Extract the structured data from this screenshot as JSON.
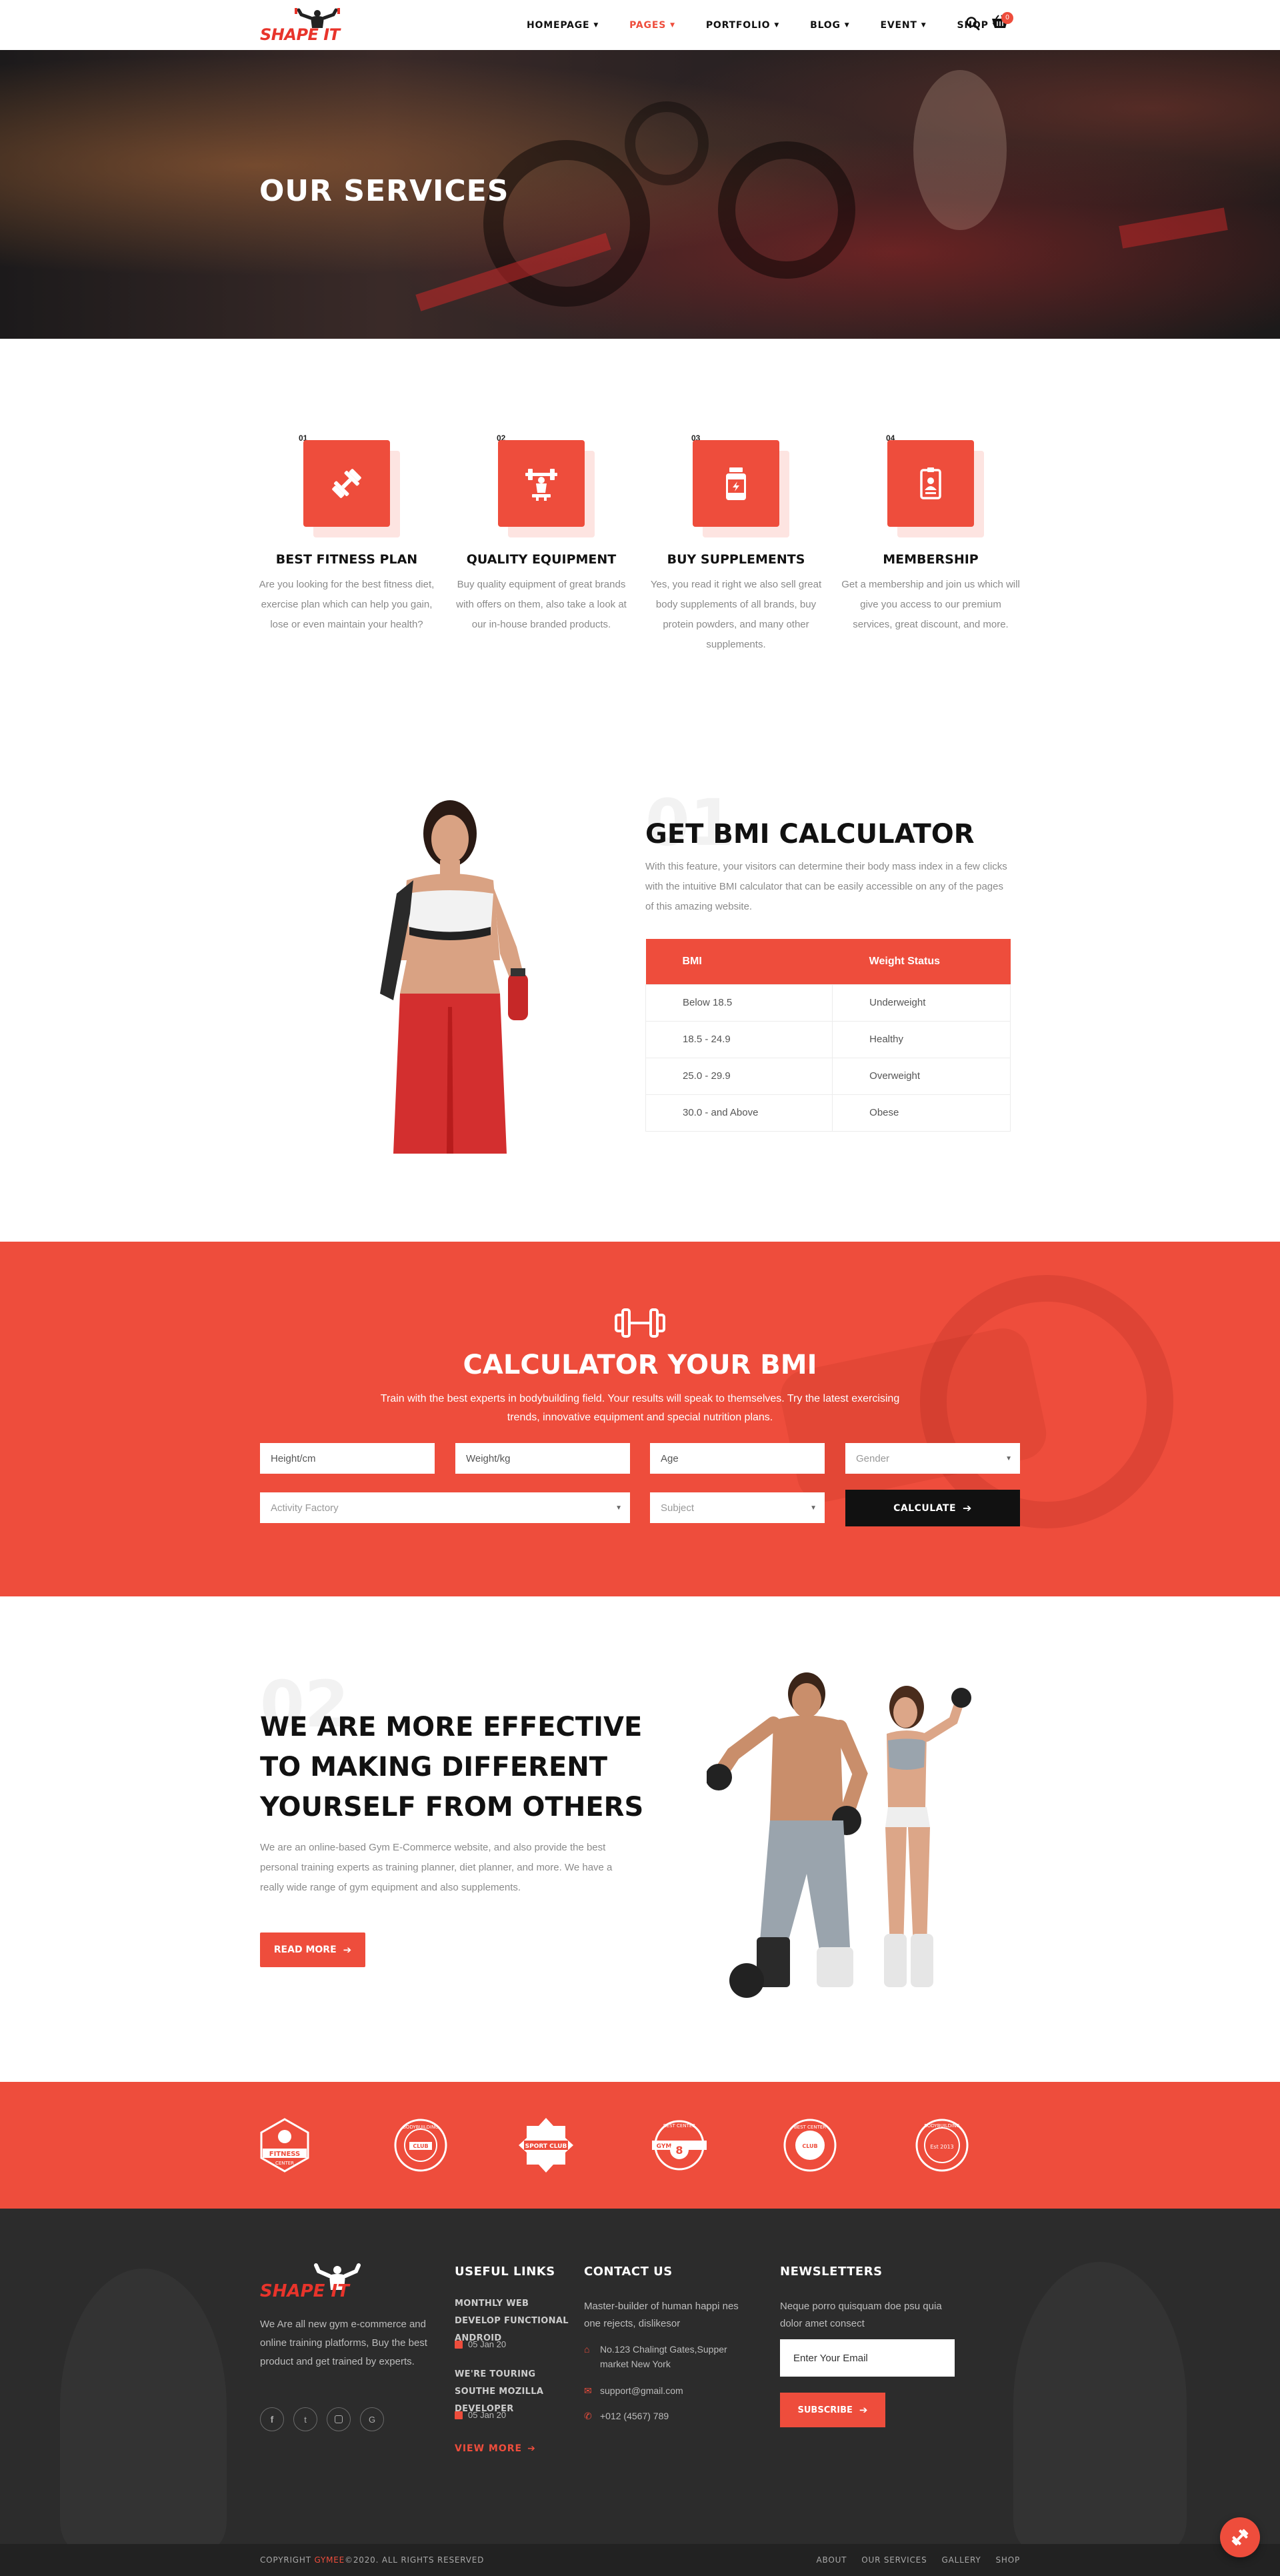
{
  "brand": {
    "logo_text": "SHAPE IT",
    "accent": "#ee4d3c"
  },
  "nav": {
    "items": [
      {
        "label": "HOMEPAGE",
        "active": false
      },
      {
        "label": "PAGES",
        "active": true
      },
      {
        "label": "PORTFOLIO",
        "active": false
      },
      {
        "label": "BLOG",
        "active": false
      },
      {
        "label": "EVENT",
        "active": false
      },
      {
        "label": "SHOP",
        "active": false
      }
    ],
    "cart_count": "0",
    "icons": [
      "search-icon",
      "cart-icon"
    ]
  },
  "hero": {
    "title": "OUR SERVICES"
  },
  "services": [
    {
      "num": "01",
      "title": "BEST FITNESS PLAN",
      "desc": "Are you looking for the best fitness diet, exercise plan which can help you gain, lose or even maintain your health?",
      "icon": "dumbbell-icon"
    },
    {
      "num": "02",
      "title": "QUALITY EQUIPMENT",
      "desc": "Buy quality equipment of great brands with offers on them, also take a look at our in-house branded products.",
      "icon": "barbell-icon"
    },
    {
      "num": "03",
      "title": "BUY SUPPLEMENTS",
      "desc": "Yes, you read it right we also sell great body supplements of all brands, buy protein powders, and many other supplements.",
      "icon": "supplement-jar-icon"
    },
    {
      "num": "04",
      "title": "MEMBERSHIP",
      "desc": "Get a membership and join us which will give you access to our premium services, great discount, and more.",
      "icon": "id-badge-icon"
    }
  ],
  "bmi": {
    "number": "01",
    "title": "GET BMI CALCULATOR",
    "desc": "With this feature, your visitors can determine their body mass index in a few clicks with the intuitive BMI calculator that can be easily accessible on any of the pages of this amazing website.",
    "table": {
      "headers": [
        "BMI",
        "Weight Status"
      ],
      "rows": [
        [
          "Below 18.5",
          "Underweight"
        ],
        [
          "18.5 - 24.9",
          "Healthy"
        ],
        [
          "25.0 - 29.9",
          "Overweight"
        ],
        [
          "30.0 - and Above",
          "Obese"
        ]
      ]
    }
  },
  "calculator": {
    "title": "CALCULATOR YOUR BMI",
    "desc": "Train with the best experts in bodybuilding field. Your results will speak to themselves. Try the latest exercising trends, innovative equipment and special nutrition plans.",
    "height_placeholder": "Height/cm",
    "weight_placeholder": "Weight/kg",
    "age_placeholder": "Age",
    "gender_select": "Gender",
    "activity_select": "Activity Factory",
    "subject_select": "Subject",
    "button": "CALCULATE"
  },
  "effective": {
    "number": "02",
    "title": "WE ARE MORE EFFECTIVE TO MAKING DIFFERENT YOURSELF FROM OTHERS",
    "desc": "We are an online-based Gym E-Commerce website, and also provide the best personal training experts as training planner, diet planner, and more. We have a really wide range of gym equipment and also supplements.",
    "button": "READ MORE"
  },
  "brand_logos": [
    {
      "label": "FITNESS",
      "sub": "CENTER"
    },
    {
      "label": "BODYBUILDING",
      "sub": "CLUB"
    },
    {
      "label": "SPORT CLUB",
      "sub": ""
    },
    {
      "label": "GYM",
      "sub": "BEST CENTER"
    },
    {
      "label": "BEST CENTER",
      "sub": "CLUB"
    },
    {
      "label": "BODYBUILDING",
      "sub": "Est 2013"
    }
  ],
  "footer": {
    "about": "We Are all new gym e-commerce and online training platforms, Buy the best product and get trained by experts.",
    "social": [
      "facebook-icon",
      "twitter-icon",
      "instagram-icon",
      "google-icon"
    ],
    "useful_links": {
      "heading": "USEFUL LINKS",
      "posts": [
        {
          "title": "MONTHLY WEB DEVELOP FUNCTIONAL ANDROID",
          "date": "05 Jan 20"
        },
        {
          "title": "WE'RE TOURING SOUTHE MOZILLA DEVELOPER",
          "date": "05 Jan 20"
        }
      ],
      "view_more": "VIEW MORE"
    },
    "contact": {
      "heading": "CONTACT US",
      "desc": "Master-builder of human happi nes one rejects, dislikesor",
      "address": "No.123 Chalingt Gates,Supper market New York",
      "email": "support@gmail.com",
      "phone": "+012 (4567) 789"
    },
    "newsletter": {
      "heading": "NEWSLETTERS",
      "desc": "Neque porro quisquam doe psu quia dolor amet consect",
      "placeholder": "Enter Your Email",
      "button": "SUBSCRIBE"
    }
  },
  "bottom": {
    "copyright_prefix": "COPYRIGHT",
    "copyright_brand": "GYMEE",
    "copyright_suffix": "©2020. ALL RIGHTS RESERVED",
    "links": [
      "ABOUT",
      "OUR SERVICES",
      "GALLERY",
      "SHOP"
    ]
  }
}
